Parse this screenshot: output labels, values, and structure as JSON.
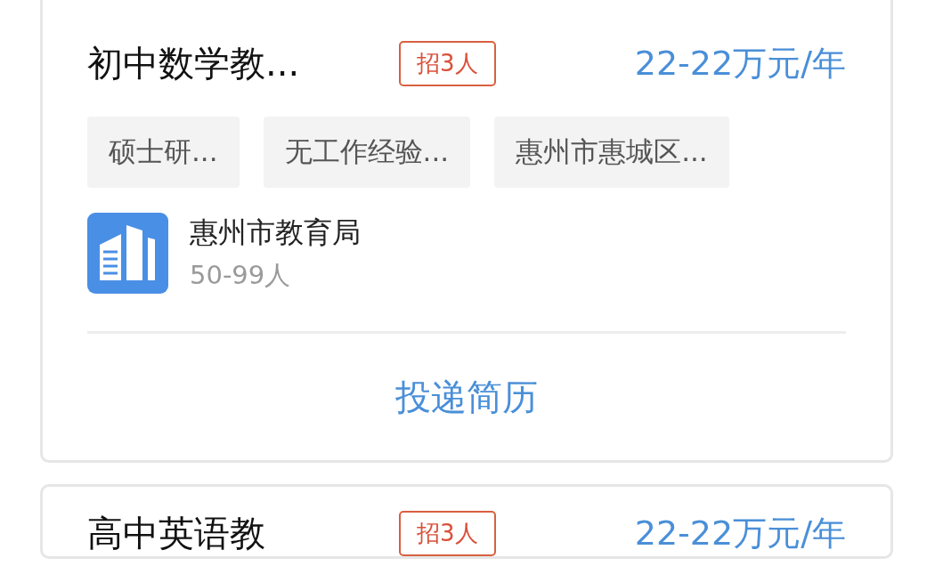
{
  "jobs": [
    {
      "title": "初中数学教...",
      "headcount": "招3人",
      "salary": "22-22万元/年",
      "tags": [
        "硕士研...",
        "无工作经验...",
        "惠州市惠城区..."
      ],
      "company": {
        "name": "惠州市教育局",
        "size": "50-99人"
      },
      "apply_label": "投递简历"
    },
    {
      "title": "高中英语教",
      "headcount": "招3人",
      "salary": "22-22万元/年"
    }
  ]
}
